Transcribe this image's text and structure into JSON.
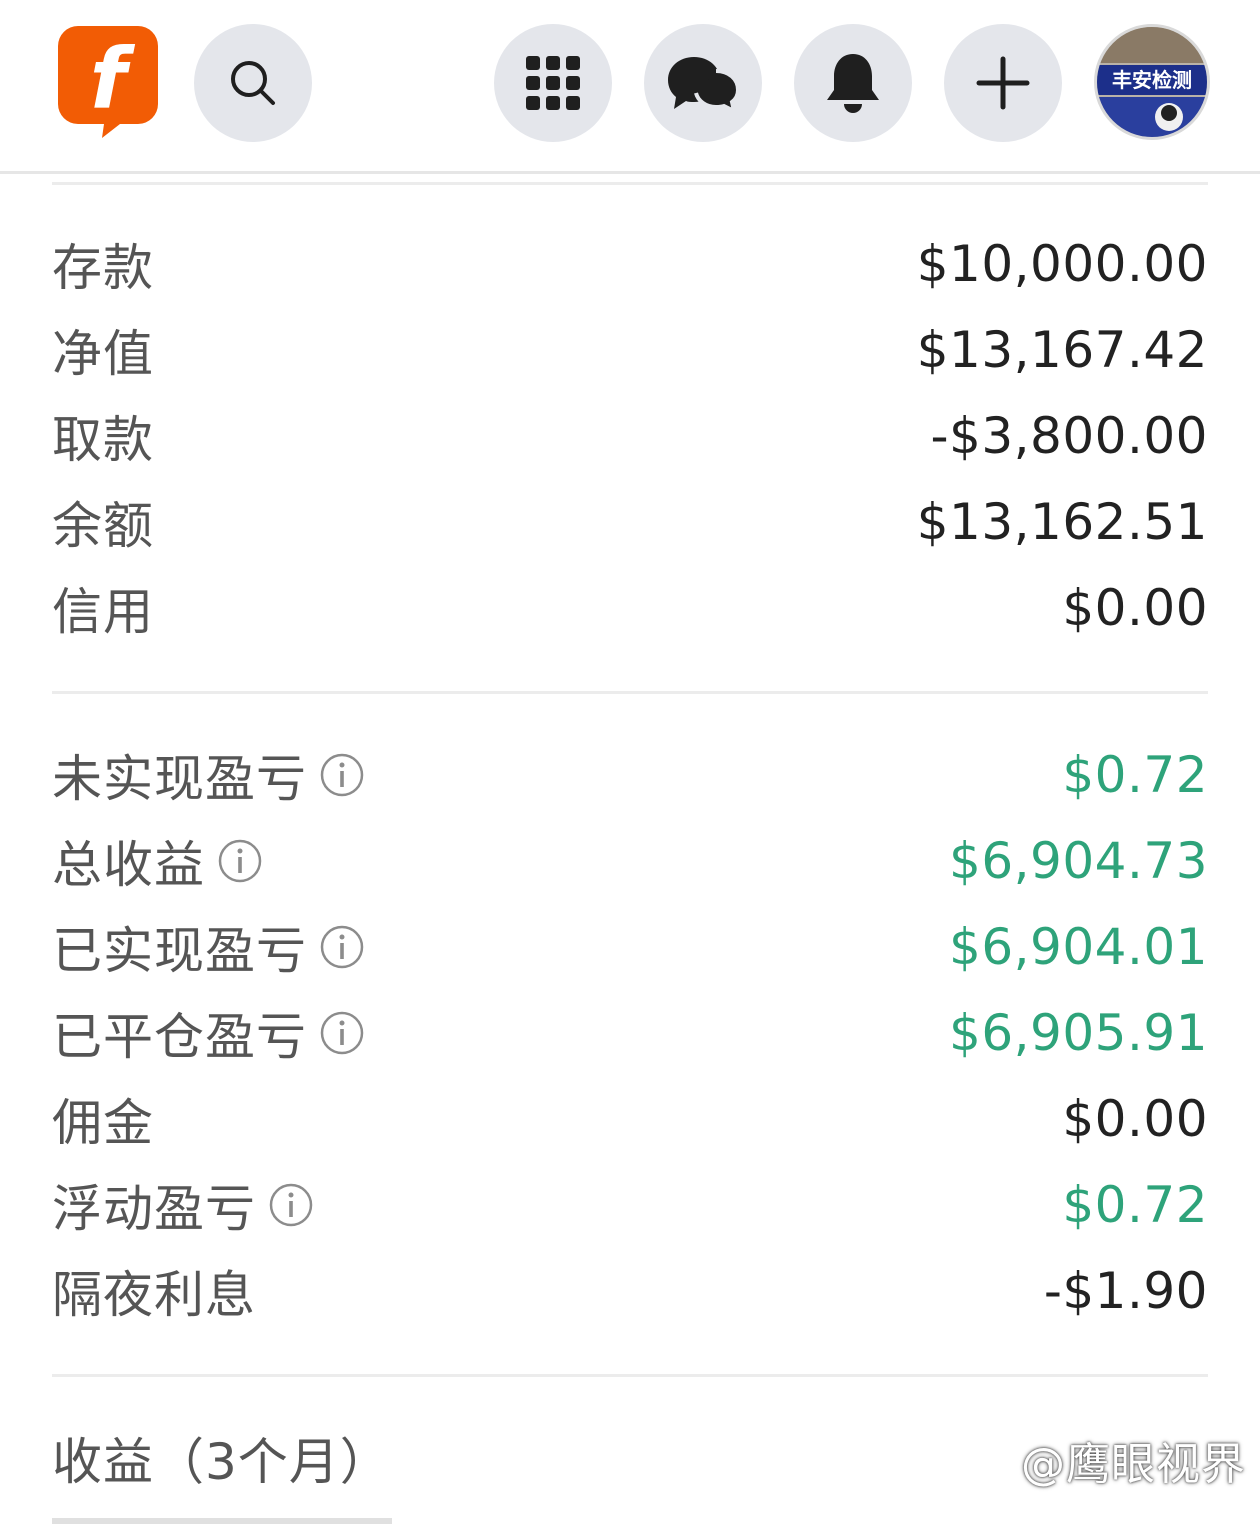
{
  "topbar": {
    "logo_letter": "f",
    "brand_color": "#f25c05",
    "icons": [
      "search-icon",
      "apps-grid-icon",
      "chat-bubbles-icon",
      "bell-icon",
      "plus-icon"
    ],
    "avatar_text": "丰安检测"
  },
  "account": [
    {
      "label": "存款",
      "value": "$10,000.00"
    },
    {
      "label": "净值",
      "value": "$13,167.42"
    },
    {
      "label": "取款",
      "value": "-$3,800.00"
    },
    {
      "label": "余额",
      "value": "$13,162.51"
    },
    {
      "label": "信用",
      "value": "$0.00"
    }
  ],
  "pnl": [
    {
      "label": "未实现盈亏",
      "value": "$0.72",
      "info": true,
      "positive": true
    },
    {
      "label": "总收益",
      "value": "$6,904.73",
      "info": true,
      "positive": true
    },
    {
      "label": "已实现盈亏",
      "value": "$6,904.01",
      "info": true,
      "positive": true
    },
    {
      "label": "已平仓盈亏",
      "value": "$6,905.91",
      "info": true,
      "positive": true
    },
    {
      "label": "佣金",
      "value": "$0.00",
      "info": false,
      "positive": false
    },
    {
      "label": "浮动盈亏",
      "value": "$0.72",
      "info": true,
      "positive": true
    },
    {
      "label": "隔夜利息",
      "value": "-$1.90",
      "info": false,
      "positive": false
    }
  ],
  "returns": {
    "label": "收益（3个月）",
    "value": ""
  },
  "watermark": "@鹰眼视界",
  "colors": {
    "positive": "#2ea37a",
    "label": "#555555",
    "value": "#222222",
    "icon_bg": "#e4e6eb"
  }
}
